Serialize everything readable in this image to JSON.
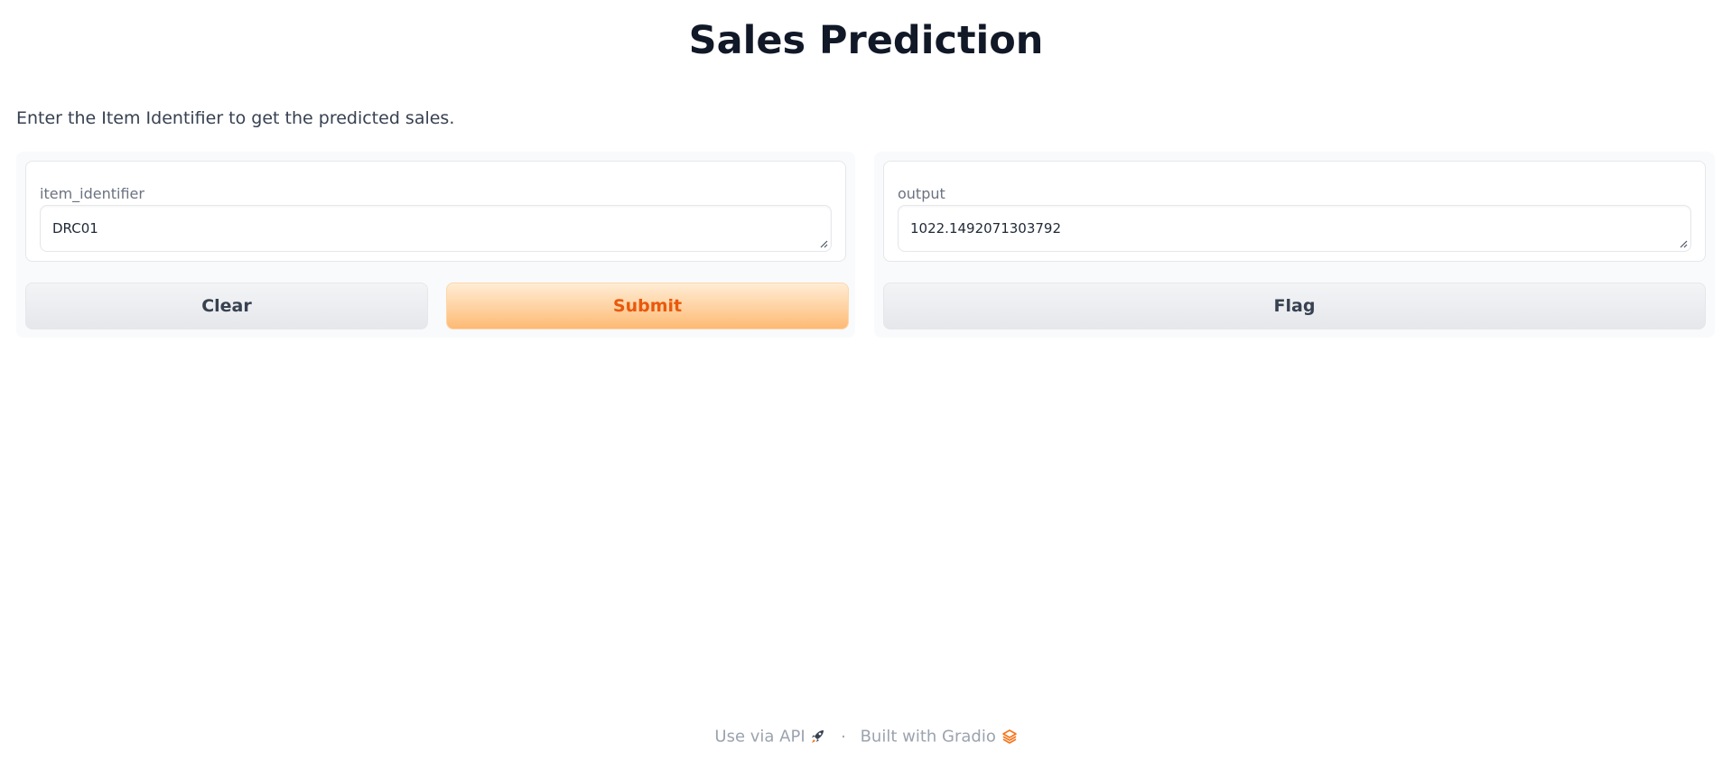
{
  "page": {
    "title": "Sales Prediction",
    "description": "Enter the Item Identifier to get the predicted sales."
  },
  "input": {
    "label": "item_identifier",
    "value": "DRC01"
  },
  "output": {
    "label": "output",
    "value": "1022.1492071303792"
  },
  "buttons": {
    "clear": "Clear",
    "submit": "Submit",
    "flag": "Flag"
  },
  "footer": {
    "api_link": "Use via API",
    "api_icon": "rocket-icon",
    "separator": "·",
    "built_with": "Built with Gradio",
    "gradio_icon": "gradio-logo-icon"
  },
  "colors": {
    "accent": "#ea580c",
    "accent_bg": "#fdba74"
  }
}
